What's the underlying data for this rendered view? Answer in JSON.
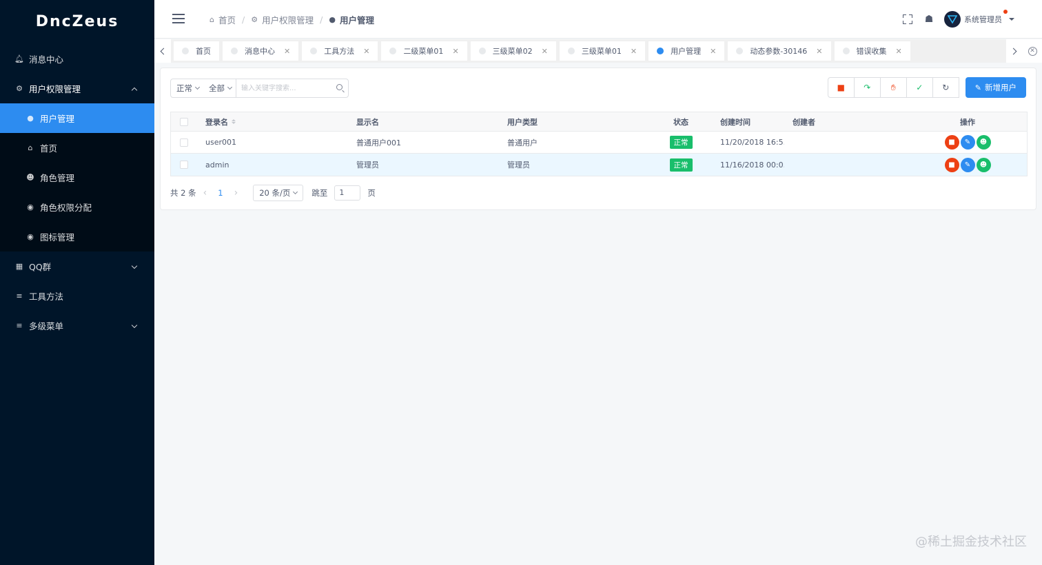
{
  "app": {
    "logo": "DncZeus"
  },
  "sidebar": {
    "items": [
      {
        "label": "消息中心",
        "icon": "bell-icon"
      },
      {
        "label": "用户权限管理",
        "icon": "gear-icon",
        "expanded": true,
        "children": [
          {
            "label": "用户管理",
            "icon": "user-circle-icon",
            "active": true
          },
          {
            "label": "首页",
            "icon": "home-icon"
          },
          {
            "label": "角色管理",
            "icon": "people-icon"
          },
          {
            "label": "角色权限分配",
            "icon": "globe-icon"
          },
          {
            "label": "图标管理",
            "icon": "circle-icon"
          }
        ]
      },
      {
        "label": "QQ群",
        "icon": "grid-icon"
      },
      {
        "label": "工具方法",
        "icon": "list-icon"
      },
      {
        "label": "多级菜单",
        "icon": "list-icon"
      }
    ]
  },
  "header": {
    "breadcrumb": [
      "首页",
      "用户权限管理",
      "用户管理"
    ],
    "user": "系统管理员"
  },
  "tabs": [
    {
      "label": "首页",
      "closable": false
    },
    {
      "label": "消息中心",
      "closable": true
    },
    {
      "label": "工具方法",
      "closable": true
    },
    {
      "label": "二级菜单01",
      "closable": true
    },
    {
      "label": "三级菜单02",
      "closable": true
    },
    {
      "label": "三级菜单01",
      "closable": true
    },
    {
      "label": "用户管理",
      "closable": true,
      "active": true
    },
    {
      "label": "动态参数-30146",
      "closable": true
    },
    {
      "label": "错误收集",
      "closable": true
    }
  ],
  "filter": {
    "status": "正常",
    "type": "全部",
    "search_placeholder": "输入关键字搜索..."
  },
  "toolbar": {
    "add_label": "新增用户"
  },
  "table": {
    "headers": [
      "登录名",
      "显示名",
      "用户类型",
      "状态",
      "创建时间",
      "创建者",
      "操作"
    ],
    "rows": [
      [
        "user001",
        "普通用户001",
        "普通用户",
        "正常",
        "11/20/2018 16:5...",
        ""
      ],
      [
        "admin",
        "管理员",
        "管理员",
        "正常",
        "11/16/2018 00:0...",
        ""
      ]
    ]
  },
  "pager": {
    "total": "共 2 条",
    "page": "1",
    "size": "20 条/页",
    "jump": "跳至",
    "jump_value": "1",
    "page_unit": "页"
  },
  "colors": {
    "primary": "#2d8cf0",
    "success": "#19be6b",
    "danger": "#ed4014",
    "sidebar": "#001529"
  },
  "watermark": "@稀土掘金技术社区"
}
